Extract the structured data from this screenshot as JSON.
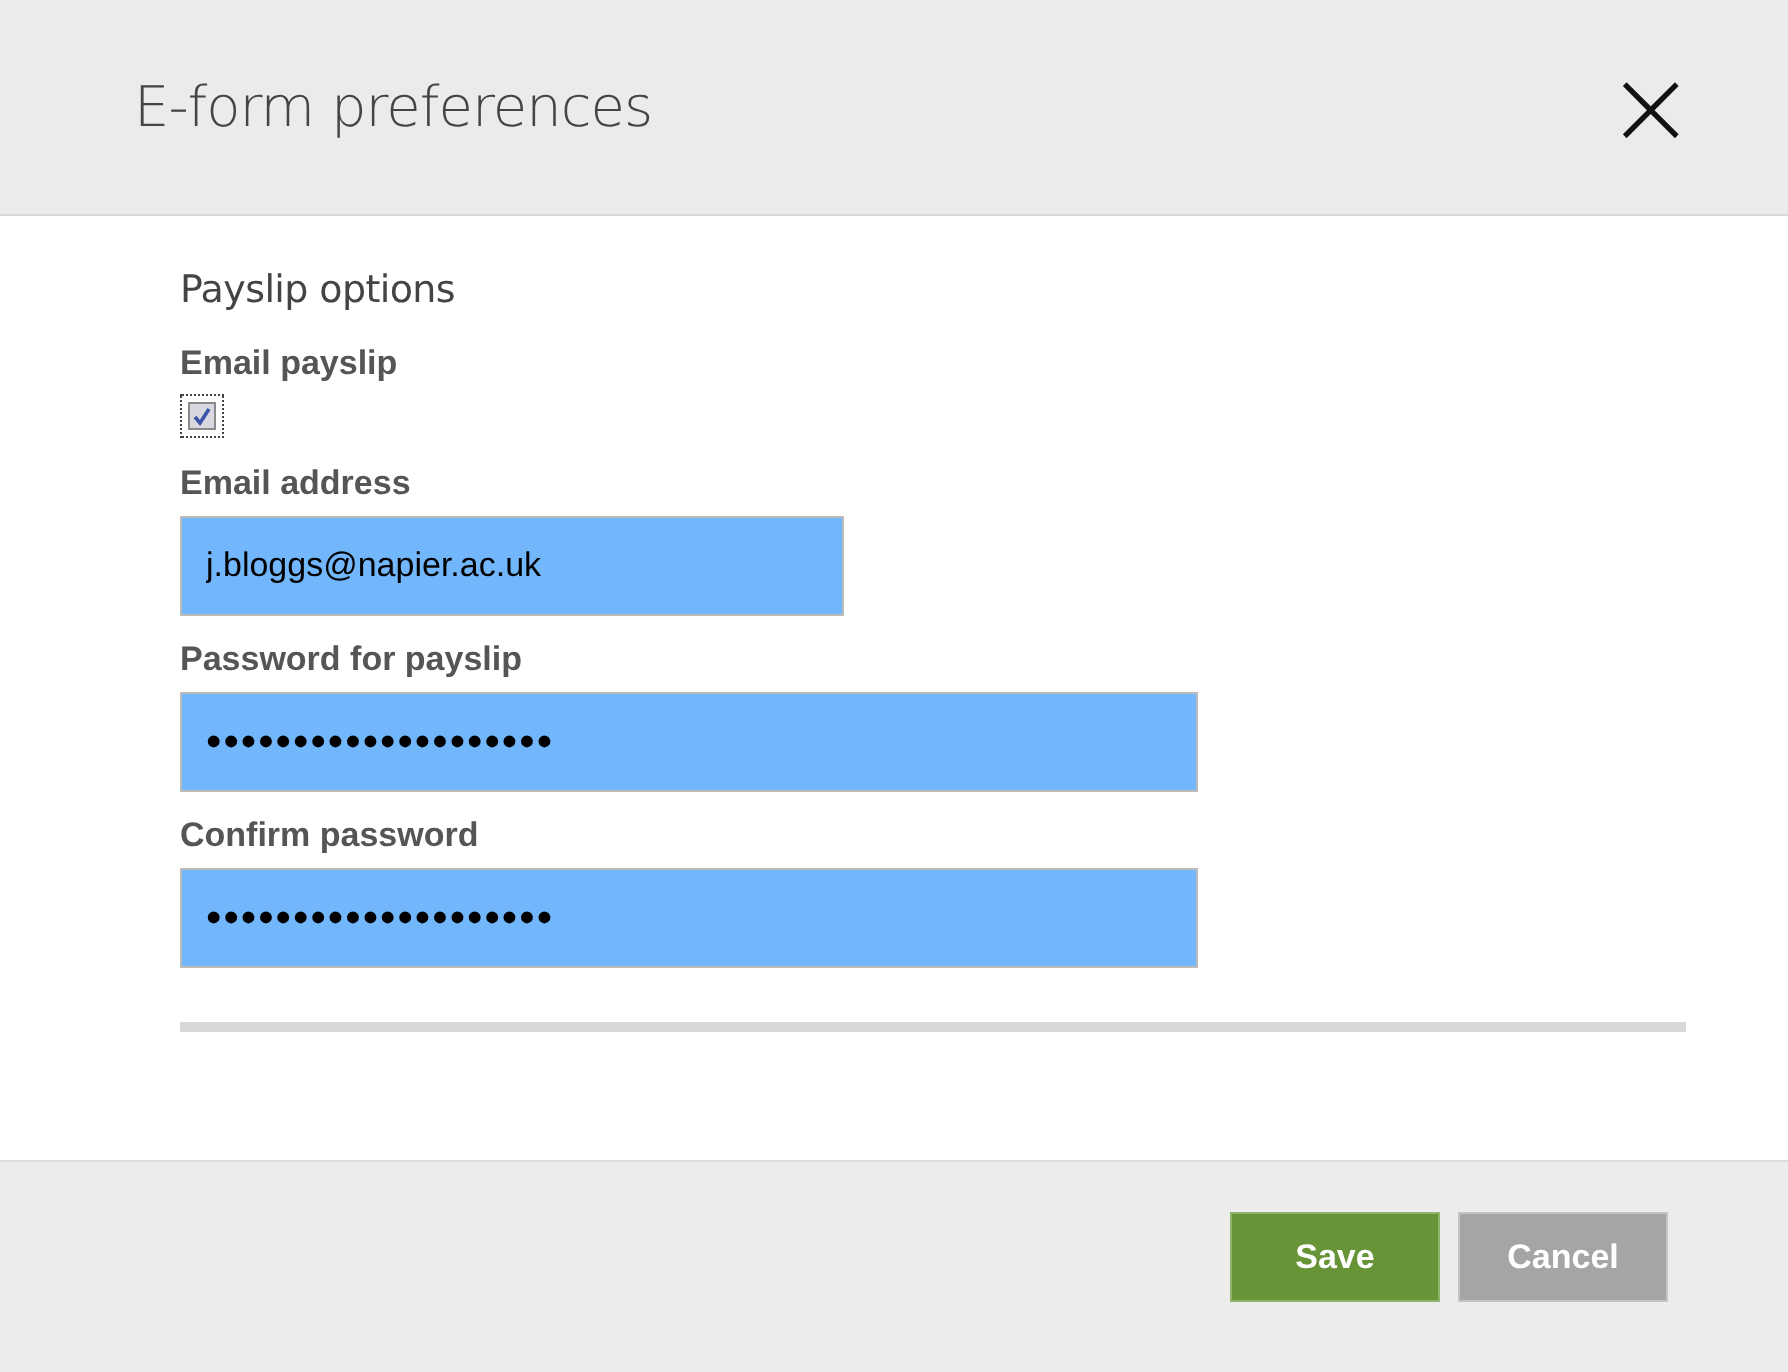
{
  "dialog": {
    "title": "E-form preferences",
    "close": "×"
  },
  "section": {
    "heading": "Payslip options"
  },
  "fields": [
    {
      "kind": "checkbox",
      "label": "Email payslip",
      "checked": true
    },
    {
      "kind": "email",
      "label": "Email address",
      "value": "j.bloggs@napier.ac.uk"
    },
    {
      "kind": "password",
      "label": "Password for payslip",
      "value": "••••••••••••••••••••"
    },
    {
      "kind": "password",
      "label": "Confirm password",
      "value": "••••••••••••••••••••"
    }
  ],
  "buttons": [
    {
      "label": "Save",
      "kind": "primary"
    },
    {
      "label": "Cancel",
      "kind": "secondary"
    }
  ]
}
